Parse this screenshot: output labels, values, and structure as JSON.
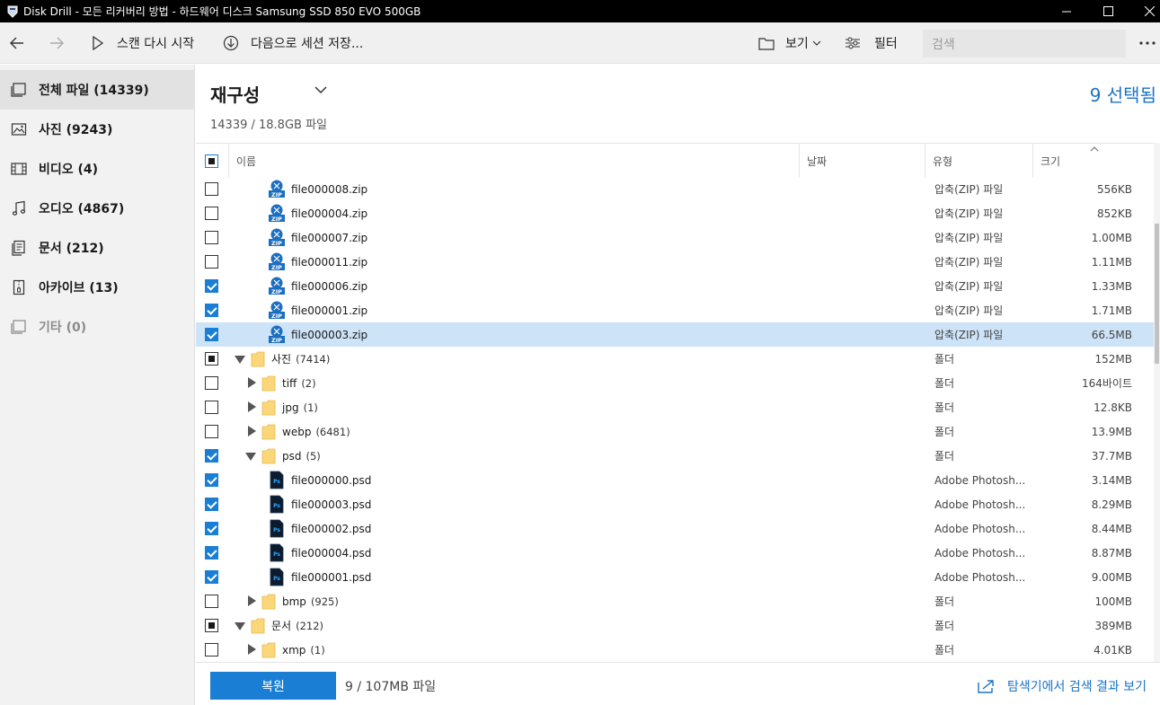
{
  "window": {
    "title": "Disk Drill - 모든 리커버리 방법 - 하드웨어 디스크 Samsung SSD 850 EVO 500GB"
  },
  "toolbar": {
    "rescan_label": "스캔 다시 시작",
    "save_session_label": "다음으로 세션 저장...",
    "view_label": "보기",
    "filter_label": "필터",
    "search_placeholder": "검색"
  },
  "sidebar": {
    "items": [
      {
        "label": "전체 파일 (14339)",
        "icon": "all-files-icon"
      },
      {
        "label": "사진 (9243)",
        "icon": "pictures-icon"
      },
      {
        "label": "비디오 (4)",
        "icon": "video-icon"
      },
      {
        "label": "오디오 (4867)",
        "icon": "audio-icon"
      },
      {
        "label": "문서 (212)",
        "icon": "documents-icon"
      },
      {
        "label": "아카이브 (13)",
        "icon": "archive-icon"
      },
      {
        "label": "기타 (0)",
        "icon": "other-icon"
      }
    ]
  },
  "main": {
    "heading": "재구성",
    "subtitle": "14339 / 18.8GB 파일",
    "selected_count": "9 선택됨"
  },
  "table": {
    "columns": [
      "이름",
      "날짜",
      "유형",
      "크기"
    ],
    "rows": [
      {
        "name": "file000008.zip",
        "type": "압축(ZIP) 파일",
        "size": "556KB"
      },
      {
        "name": "file000004.zip",
        "type": "압축(ZIP) 파일",
        "size": "852KB"
      },
      {
        "name": "file000007.zip",
        "type": "압축(ZIP) 파일",
        "size": "1.00MB"
      },
      {
        "name": "file000011.zip",
        "type": "압축(ZIP) 파일",
        "size": "1.11MB"
      },
      {
        "name": "file000006.zip",
        "type": "압축(ZIP) 파일",
        "size": "1.33MB"
      },
      {
        "name": "file000001.zip",
        "type": "압축(ZIP) 파일",
        "size": "1.71MB"
      },
      {
        "name": "file000003.zip",
        "type": "압축(ZIP) 파일",
        "size": "66.5MB"
      },
      {
        "name": "사진",
        "count": "(7414)",
        "type": "폴더",
        "size": "152MB"
      },
      {
        "name": "tiff",
        "count": "(2)",
        "type": "폴더",
        "size": "164바이트"
      },
      {
        "name": "jpg",
        "count": "(1)",
        "type": "폴더",
        "size": "12.8KB"
      },
      {
        "name": "webp",
        "count": "(6481)",
        "type": "폴더",
        "size": "13.9MB"
      },
      {
        "name": "psd",
        "count": "(5)",
        "type": "폴더",
        "size": "37.7MB"
      },
      {
        "name": "file000000.psd",
        "type": "Adobe Photosh...",
        "size": "3.14MB"
      },
      {
        "name": "file000003.psd",
        "type": "Adobe Photosh...",
        "size": "8.29MB"
      },
      {
        "name": "file000002.psd",
        "type": "Adobe Photosh...",
        "size": "8.44MB"
      },
      {
        "name": "file000004.psd",
        "type": "Adobe Photosh...",
        "size": "8.87MB"
      },
      {
        "name": "file000001.psd",
        "type": "Adobe Photosh...",
        "size": "9.00MB"
      },
      {
        "name": "bmp",
        "count": "(925)",
        "type": "폴더",
        "size": "100MB"
      },
      {
        "name": "문서",
        "count": "(212)",
        "type": "폴더",
        "size": "389MB"
      },
      {
        "name": "xmp",
        "count": "(1)",
        "type": "폴더",
        "size": "4.01KB"
      }
    ]
  },
  "footer": {
    "recover_label": "복원",
    "info": "9 / 107MB 파일",
    "explorer_link": "탐색기에서 검색 결과 보기"
  },
  "colors": {
    "accent": "#1a7fd4",
    "selected_row": "#cde3f7"
  }
}
